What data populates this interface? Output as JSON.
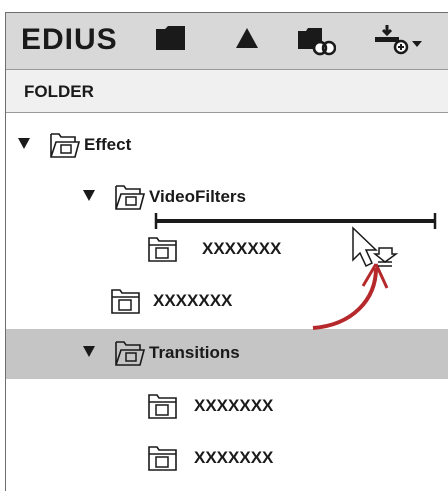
{
  "app": {
    "title": "EDIUS"
  },
  "toolbar": {
    "buttons": [
      {
        "name": "new-folder-icon"
      },
      {
        "name": "up-arrow-icon"
      },
      {
        "name": "link-folder-icon"
      },
      {
        "name": "add-item-menu-icon"
      }
    ]
  },
  "tree": {
    "header": "FOLDER",
    "items": [
      {
        "label": "Effect",
        "level": 0,
        "expanded": true,
        "type": "open-folder"
      },
      {
        "label": "VideoFilters",
        "level": 1,
        "expanded": true,
        "type": "open-folder"
      },
      {
        "label": "XXXXXXX",
        "level": 2,
        "type": "closed-folder"
      },
      {
        "label": "XXXXXXX",
        "level": 1,
        "type": "closed-folder"
      },
      {
        "label": "Transitions",
        "level": 1,
        "expanded": true,
        "type": "open-folder",
        "selected": true
      },
      {
        "label": "XXXXXXX",
        "level": 2,
        "type": "closed-folder"
      },
      {
        "label": "XXXXXXX",
        "level": 2,
        "type": "closed-folder"
      }
    ]
  },
  "colors": {
    "toolbar_bg": "#d8d8d8",
    "header_bg": "#f0f0f0",
    "selected_row": "#c5c5c5",
    "arrow": "#b5282b"
  }
}
